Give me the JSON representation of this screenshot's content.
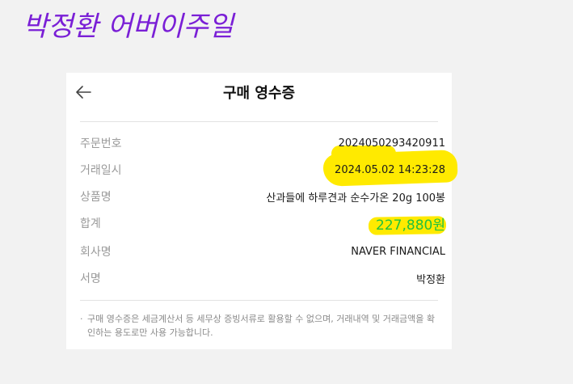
{
  "annotation": {
    "text": "박정환   어버이주일",
    "color": "#7a1fd6"
  },
  "receipt": {
    "back_icon": "arrow-left-icon",
    "title": "구매 영수증",
    "rows": [
      {
        "label": "주문번호",
        "value": "2024050293420911"
      },
      {
        "label": "거래일시",
        "value": "2024.05.02 14:23:28"
      },
      {
        "label": "상품명",
        "value": "산과들에 하루견과 순수가온 20g 100봉"
      },
      {
        "label": "합계",
        "value": "227,880원"
      },
      {
        "label": "회사명",
        "value": "NAVER FINANCIAL"
      },
      {
        "label": "서명",
        "value": "박정환"
      }
    ],
    "note": {
      "bullet": "·",
      "text": "구매 영수증은 세금계산서 등 세무상 증빙서류로 활용할 수 없으며, 거래내역 및 거래금액을 확인하는 용도로만 사용 가능합니다."
    },
    "colors": {
      "total": "#21c23d",
      "highlight": "#ffea00"
    }
  }
}
